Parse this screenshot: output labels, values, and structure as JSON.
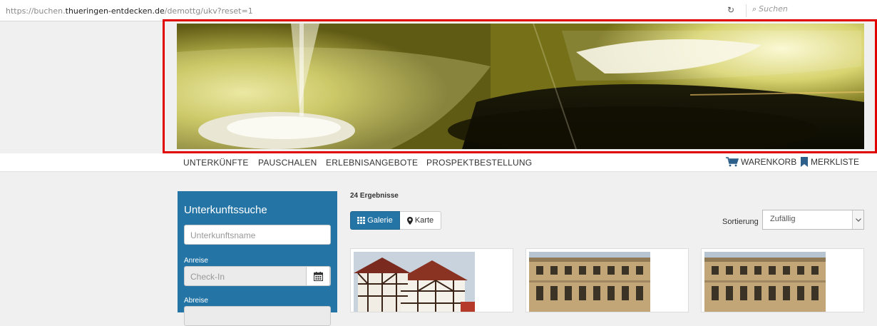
{
  "browser": {
    "url_prefix": "https://buchen.",
    "url_host": "thueringen-entdecken.de",
    "url_path": "/demottg/ukv?reset=1",
    "search_placeholder": "Suchen"
  },
  "nav": {
    "items": [
      "UNTERKÜNFTE",
      "PAUSCHALEN",
      "ERLEBNISANGEBOTE",
      "PROSPEKTBESTELLUNG"
    ],
    "cart": "WARENKORB",
    "watchlist": "MERKLISTE"
  },
  "search_panel": {
    "title": "Unterkunftssuche",
    "name_placeholder": "Unterkunftsname",
    "arrival_label": "Anreise",
    "arrival_placeholder": "Check-In",
    "departure_label": "Abreise"
  },
  "results": {
    "count_text": "24 Ergebnisse",
    "view_gallery": "Galerie",
    "view_map": "Karte",
    "sort_label": "Sortierung",
    "sort_value": "Zufällig"
  },
  "colors": {
    "primary": "#2475a6",
    "highlight_frame": "#e00000"
  }
}
